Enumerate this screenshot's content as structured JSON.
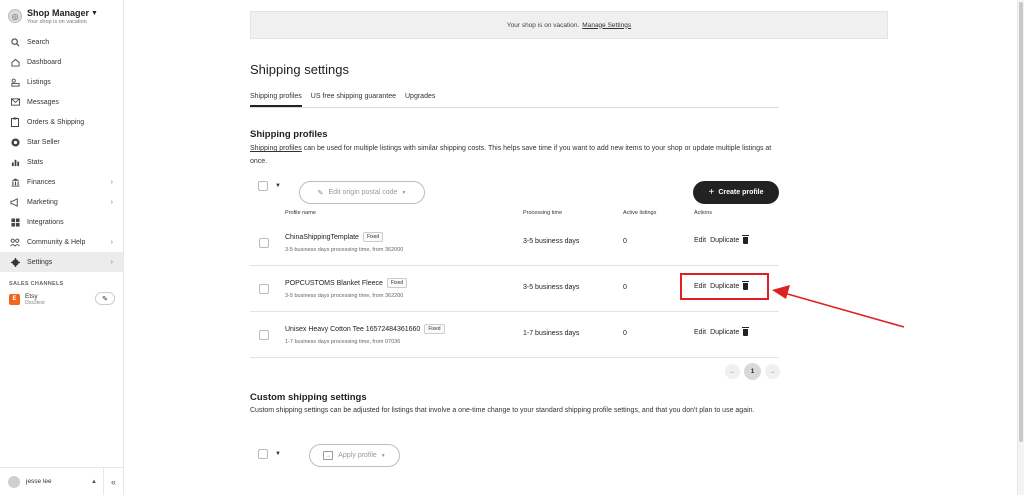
{
  "shop": {
    "title": "Shop Manager",
    "subtitle": "Your shop is on vacation"
  },
  "sidebar": {
    "items": [
      {
        "label": "Search",
        "icon": "search-icon"
      },
      {
        "label": "Dashboard",
        "icon": "home-icon"
      },
      {
        "label": "Listings",
        "icon": "listings-icon"
      },
      {
        "label": "Messages",
        "icon": "mail-icon"
      },
      {
        "label": "Orders & Shipping",
        "icon": "clipboard-icon"
      },
      {
        "label": "Star Seller",
        "icon": "star-seller-icon"
      },
      {
        "label": "Stats",
        "icon": "stats-icon"
      },
      {
        "label": "Finances",
        "icon": "bank-icon"
      },
      {
        "label": "Marketing",
        "icon": "megaphone-icon"
      },
      {
        "label": "Integrations",
        "icon": "grid-icon"
      },
      {
        "label": "Community & Help",
        "icon": "people-icon"
      },
      {
        "label": "Settings",
        "icon": "gear-icon"
      }
    ],
    "sales_channels_title": "SALES CHANNELS",
    "etsy": {
      "logo": "E",
      "name": "Etsy",
      "sub": "l3ss3test"
    },
    "user": {
      "name": "jesse lee"
    }
  },
  "vacation": {
    "text": "Your shop is on vacation.",
    "link": "Manage Settings"
  },
  "page_title": "Shipping settings",
  "tabs": [
    "Shipping profiles",
    "US free shipping guarantee",
    "Upgrades"
  ],
  "profiles": {
    "title": "Shipping profiles",
    "desc_link": "Shipping profiles",
    "desc_rest": " can be used for multiple listings with similar shipping costs. This helps save time if you want to add new items to your shop or update multiple listings at once.",
    "edit_origin": "Edit origin postal code",
    "create_button": "Create profile",
    "columns": {
      "name": "Profile name",
      "processing": "Processing time",
      "active": "Active listings",
      "actions": "Actions"
    },
    "rows": [
      {
        "name": "ChinaShippingTemplate",
        "badge": "Fixed",
        "sub": "3-5 business days processing time, from 362000",
        "processing": "3-5 business days",
        "count": "0"
      },
      {
        "name": "POPCUSTOMS Blanket Fleece",
        "badge": "Fixed",
        "sub": "3-5 business days processing time, from 362200",
        "processing": "3-5 business days",
        "count": "0"
      },
      {
        "name": "Unisex Heavy Cotton Tee 16572484361660",
        "badge": "Fixed",
        "sub": "1-7 business days processing time, from 07036",
        "processing": "1-7 business days",
        "count": "0"
      }
    ],
    "action_edit": "Edit",
    "action_duplicate": "Duplicate",
    "pager": {
      "prev": "←",
      "current": "1",
      "next": "→"
    }
  },
  "custom": {
    "title": "Custom shipping settings",
    "desc": "Custom shipping settings can be adjusted for listings that involve a one-time change to your standard shipping profile settings, and that you don't plan to use again.",
    "apply_button": "Apply profile"
  },
  "colors": {
    "highlight": "#e02020",
    "primary_button": "#222222",
    "etsy": "#f1641e"
  }
}
